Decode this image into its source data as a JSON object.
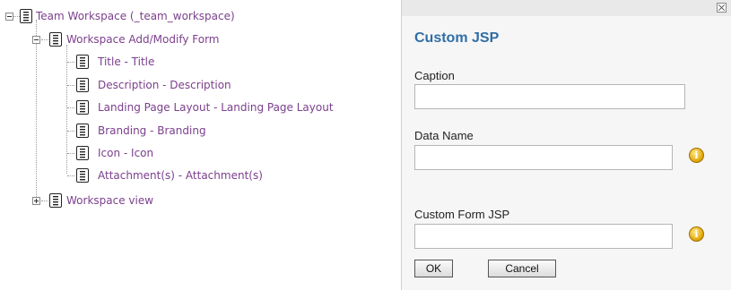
{
  "tree": {
    "root": {
      "label": "Team Workspace (_team_workspace)",
      "expanded": true
    },
    "form": {
      "label": "Workspace Add/Modify Form",
      "expanded": true
    },
    "fields": [
      {
        "label": "Title - Title"
      },
      {
        "label": "Description - Description"
      },
      {
        "label": "Landing Page Layout - Landing Page Layout"
      },
      {
        "label": "Branding - Branding"
      },
      {
        "label": "Icon - Icon"
      },
      {
        "label": "Attachment(s) - Attachment(s)"
      }
    ],
    "view": {
      "label": "Workspace view",
      "expanded": false
    }
  },
  "dialog": {
    "title": "Custom JSP",
    "caption": {
      "label": "Caption",
      "value": ""
    },
    "data_name": {
      "label": "Data Name",
      "value": ""
    },
    "custom_form_jsp": {
      "label": "Custom Form JSP",
      "value": ""
    },
    "info_icon": "i",
    "ok_label": "OK",
    "cancel_label": "Cancel"
  },
  "colors": {
    "tree_link": "#7b3f8c",
    "dialog_title": "#2f6ea5",
    "info_icon": "#e0a400"
  },
  "icons": [
    "expand-collapse-icon",
    "document-icon",
    "info-icon",
    "close-icon"
  ]
}
